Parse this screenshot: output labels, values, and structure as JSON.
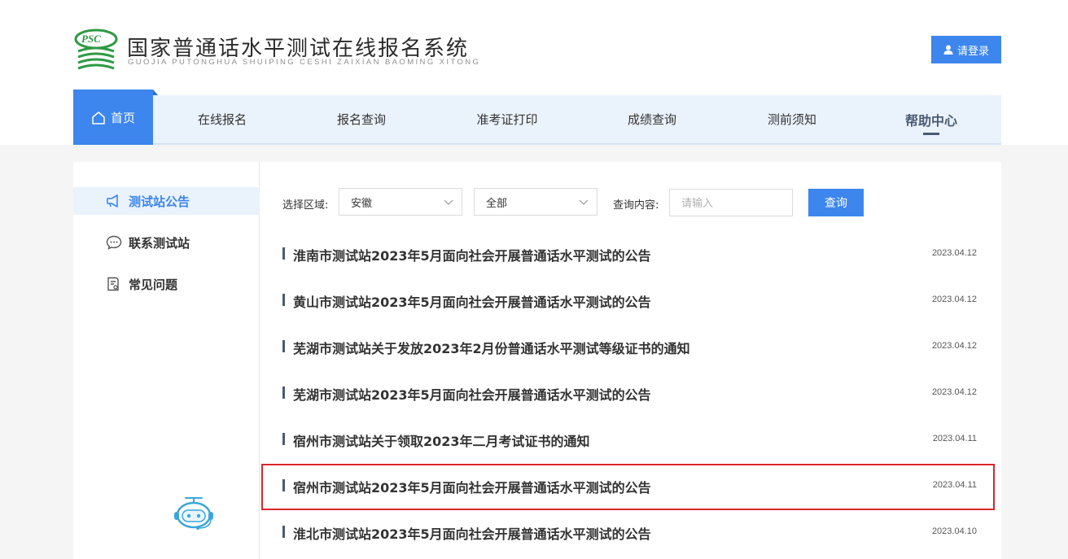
{
  "header": {
    "logo_badge": "PSC",
    "title": "国家普通话水平测试在线报名系统",
    "subtitle": "GUOJIA PUTONGHUA SHUIPING CESHI ZAIXIAN BAOMING XITONG",
    "login_label": "请登录",
    "login_icon": "user-icon"
  },
  "nav": {
    "home_label": "首页",
    "home_icon": "home-icon",
    "items": [
      {
        "label": "在线报名"
      },
      {
        "label": "报名查询"
      },
      {
        "label": "准考证打印"
      },
      {
        "label": "成绩查询"
      },
      {
        "label": "测前须知"
      },
      {
        "label": "帮助中心",
        "active": true
      }
    ]
  },
  "sidebar": {
    "items": [
      {
        "label": "测试站公告",
        "icon": "megaphone-icon",
        "active": true
      },
      {
        "label": "联系测试站",
        "icon": "chat-icon"
      },
      {
        "label": "常见问题",
        "icon": "document-icon"
      }
    ],
    "assistant_icon": "robot-assistant-icon"
  },
  "filters": {
    "region_label": "选择区域:",
    "region_value": "安徽",
    "category_value": "全部",
    "query_label": "查询内容:",
    "query_placeholder": "请输入",
    "search_button": "查询"
  },
  "announcements": [
    {
      "title": "淮南市测试站2023年5月面向社会开展普通话水平测试的公告",
      "date": "2023.04.12"
    },
    {
      "title": "黄山市测试站2023年5月面向社会开展普通话水平测试的公告",
      "date": "2023.04.12"
    },
    {
      "title": "芜湖市测试站关于发放2023年2月份普通话水平测试等级证书的通知",
      "date": "2023.04.12"
    },
    {
      "title": "芜湖市测试站2023年5月面向社会开展普通话水平测试的公告",
      "date": "2023.04.12"
    },
    {
      "title": "宿州市测试站关于领取2023年二月考试证书的通知",
      "date": "2023.04.11"
    },
    {
      "title": "宿州市测试站2023年5月面向社会开展普通话水平测试的公告",
      "date": "2023.04.11",
      "highlighted": true
    },
    {
      "title": "淮北市测试站2023年5月面向社会开展普通话水平测试的公告",
      "date": "2023.04.10"
    }
  ],
  "colors": {
    "accent": "#3c86ee",
    "nav_bg": "#eaf2fc",
    "highlight_border": "#d9262a",
    "logo_green": "#2f9a45"
  }
}
